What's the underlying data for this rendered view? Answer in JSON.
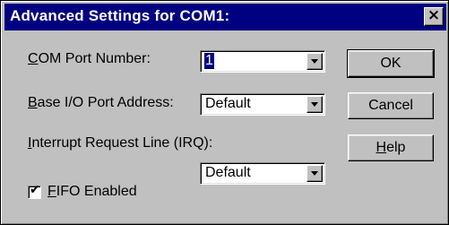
{
  "window": {
    "title": "Advanced Settings for COM1:",
    "close_glyph": "×"
  },
  "fields": {
    "com_port": {
      "label_ul": "C",
      "label_rest": "OM Port Number:",
      "value": "1"
    },
    "base_io": {
      "label_ul": "B",
      "label_rest": "ase I/O Port Address:",
      "value": "Default"
    },
    "irq": {
      "label_ul": "I",
      "label_rest": "nterrupt Request Line (IRQ):",
      "value": "Default"
    },
    "fifo": {
      "label_ul": "F",
      "label_rest": "IFO Enabled",
      "checked": true,
      "check_glyph": "✔"
    }
  },
  "buttons": {
    "ok": "OK",
    "cancel": "Cancel",
    "help_ul": "H",
    "help_rest": "elp"
  },
  "colors": {
    "face": "#c0c0c0",
    "titlebar": "#000080",
    "selection": "#000080"
  }
}
